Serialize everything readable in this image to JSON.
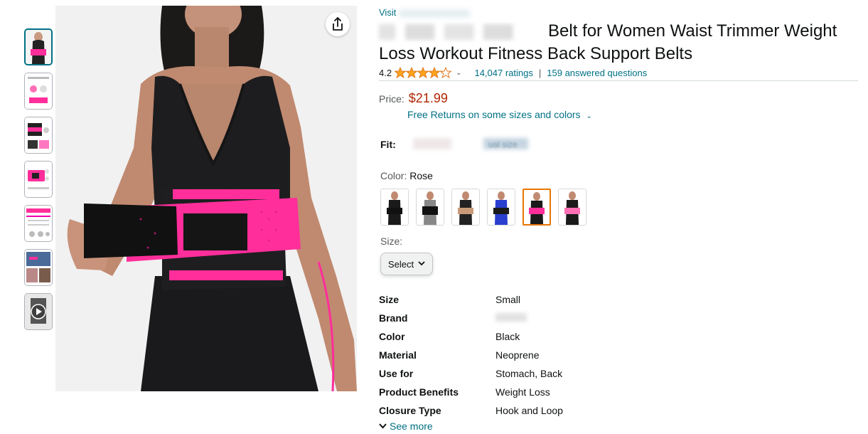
{
  "visit_link": "Visit",
  "title_text": "Belt for Women Waist Trimmer Weight Loss Workout Fitness Back Support Belts",
  "rating": {
    "value": "4.2",
    "stars": 4.2,
    "ratings_count": "14,047 ratings",
    "separator": "|",
    "questions": "159 answered questions"
  },
  "price": {
    "label": "Price:",
    "value": "$21.99"
  },
  "returns": "Free Returns on some sizes and colors",
  "fit_label": "Fit:",
  "fit_value_partial": "ual size",
  "color": {
    "label": "Color:",
    "selected": "Rose",
    "swatch_count": 6
  },
  "size": {
    "label": "Size:",
    "select_label": "Select"
  },
  "details": [
    {
      "key": "Size",
      "value": "Small"
    },
    {
      "key": "Brand",
      "value": ""
    },
    {
      "key": "Color",
      "value": "Black"
    },
    {
      "key": "Material",
      "value": "Neoprene"
    },
    {
      "key": "Use for",
      "value": "Stomach, Back"
    },
    {
      "key": "Product Benefits",
      "value": "Weight Loss"
    },
    {
      "key": "Closure Type",
      "value": "Hook and Loop"
    }
  ],
  "see_more": "See more",
  "colors": {
    "link": "#007185",
    "price": "#b12704",
    "star": "#ffa41c",
    "selected_swatch": "#e77600",
    "belt_pink": "#ff2e9a"
  },
  "icons": {
    "share": "share-icon",
    "video": "play-icon",
    "dropdown": "chevron-down-icon"
  }
}
